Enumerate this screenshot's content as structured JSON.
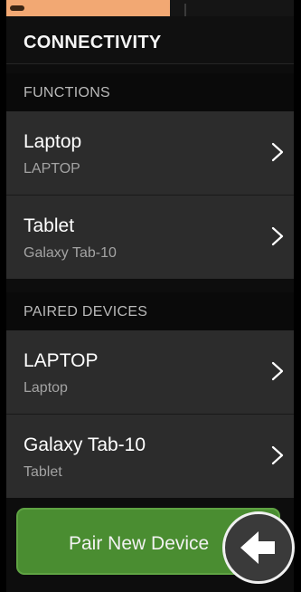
{
  "status_strip": {
    "progress_fraction": 0.57,
    "accent_color": "#f2a873"
  },
  "header": {
    "title": "CONNECTIVITY"
  },
  "functions_section": {
    "label": "FUNCTIONS",
    "items": [
      {
        "primary": "Laptop",
        "secondary": "LAPTOP",
        "icon": "chevron-right-icon"
      },
      {
        "primary": "Tablet",
        "secondary": "Galaxy Tab-10",
        "icon": "chevron-right-icon"
      }
    ]
  },
  "paired_section": {
    "label": "PAIRED DEVICES",
    "items": [
      {
        "primary": "LAPTOP",
        "secondary": "Laptop",
        "icon": "chevron-right-icon"
      },
      {
        "primary": "Galaxy Tab-10",
        "secondary": "Tablet",
        "icon": "chevron-right-icon"
      }
    ]
  },
  "actions": {
    "pair_label": "Pair New Device",
    "pair_color": "#4a8d31",
    "back_icon": "arrow-left-icon"
  }
}
